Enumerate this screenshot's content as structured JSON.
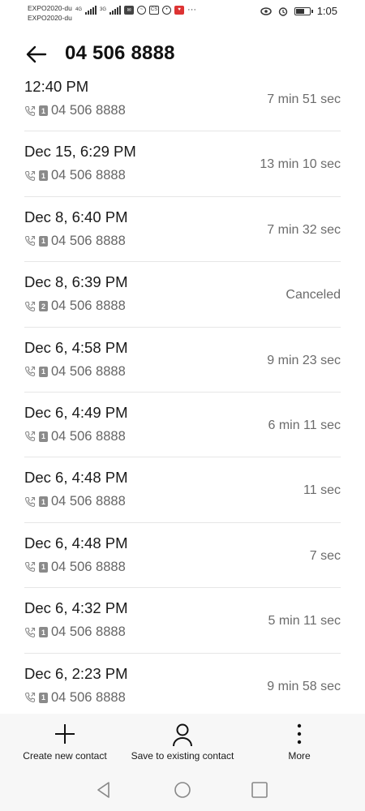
{
  "status_bar": {
    "carrier_1": "EXPO2020-du",
    "carrier_2": "EXPO2020-du",
    "net_1": "4G",
    "net_2": "3G",
    "cs_label": "CS",
    "more_dots": "···",
    "time": "1:05",
    "battery_level": 0.7
  },
  "header": {
    "title": "04 506 8888"
  },
  "calls": [
    {
      "time": "12:40 PM",
      "sim": "1",
      "number": "04 506 8888",
      "duration": "7 min 51 sec"
    },
    {
      "time": "Dec 15, 6:29 PM",
      "sim": "1",
      "number": "04 506 8888",
      "duration": "13 min 10 sec"
    },
    {
      "time": "Dec 8, 6:40 PM",
      "sim": "1",
      "number": "04 506 8888",
      "duration": "7 min 32 sec"
    },
    {
      "time": "Dec 8, 6:39 PM",
      "sim": "2",
      "number": "04 506 8888",
      "duration": "Canceled"
    },
    {
      "time": "Dec 6, 4:58 PM",
      "sim": "1",
      "number": "04 506 8888",
      "duration": "9 min 23 sec"
    },
    {
      "time": "Dec 6, 4:49 PM",
      "sim": "1",
      "number": "04 506 8888",
      "duration": "6 min 11 sec"
    },
    {
      "time": "Dec 6, 4:48 PM",
      "sim": "1",
      "number": "04 506 8888",
      "duration": "11 sec"
    },
    {
      "time": "Dec 6, 4:48 PM",
      "sim": "1",
      "number": "04 506 8888",
      "duration": "7 sec"
    },
    {
      "time": "Dec 6, 4:32 PM",
      "sim": "1",
      "number": "04 506 8888",
      "duration": "5 min 11 sec"
    },
    {
      "time": "Dec 6, 2:23 PM",
      "sim": "1",
      "number": "04 506 8888",
      "duration": "9 min 58 sec"
    }
  ],
  "actions": {
    "create_new_contact": "Create new contact",
    "save_to_existing_contact": "Save to existing contact",
    "more": "More"
  }
}
